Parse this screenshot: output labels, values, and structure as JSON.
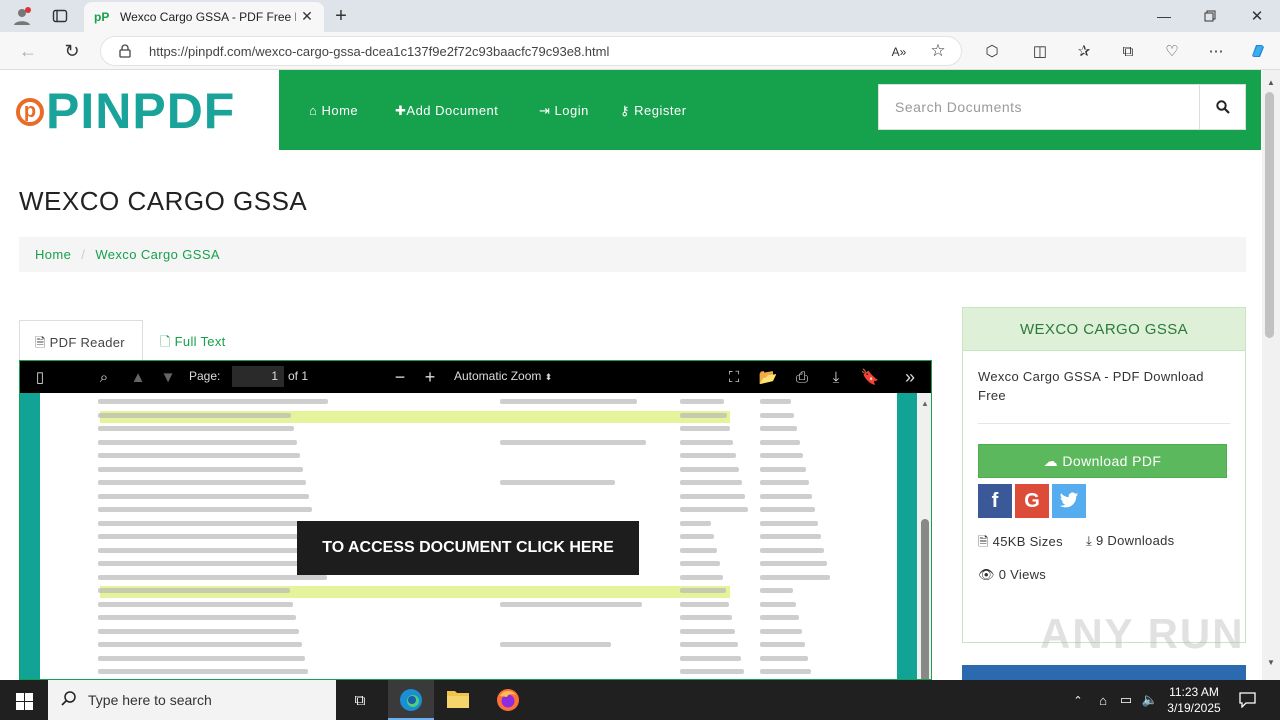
{
  "browser": {
    "tab_title": "Wexco Cargo GSSA - PDF Free Do",
    "tab_favicon": "pP",
    "url": "https://pinpdf.com/wexco-cargo-gssa-dcea1c137f9e2f72c93baacfc79c93e8.html"
  },
  "site": {
    "logo_text": "PINPDF",
    "logo_mark": "p",
    "nav": [
      {
        "icon": "home-icon",
        "label": "Home"
      },
      {
        "icon": "plus-icon",
        "label": "Add Document"
      },
      {
        "icon": "login-icon",
        "label": "Login"
      },
      {
        "icon": "key-icon",
        "label": "Register"
      }
    ],
    "search_placeholder": "Search Documents",
    "accent": "#16a14c"
  },
  "page": {
    "title": "WEXCO CARGO GSSA",
    "breadcrumb": [
      "Home",
      "/",
      "Wexco Cargo GSSA"
    ],
    "tabs": [
      "PDF Reader",
      "Full Text"
    ]
  },
  "viewer": {
    "page_label": "Page:",
    "page_num": "1",
    "page_of": "of 1",
    "zoom": "Automatic Zoom",
    "cta": "TO ACCESS DOCUMENT CLICK HERE"
  },
  "sidebar": {
    "title": "WEXCO CARGO GSSA",
    "description": "Wexco Cargo GSSA - PDF Download Free",
    "download_label": "Download PDF",
    "social": [
      "f",
      "G",
      "t"
    ],
    "size": "45KB Sizes",
    "downloads": "9 Downloads",
    "views": "0 Views"
  },
  "watermark": "ANY RUN",
  "taskbar": {
    "search_placeholder": "Type here to search",
    "time": "11:23 AM",
    "date": "3/19/2025"
  }
}
